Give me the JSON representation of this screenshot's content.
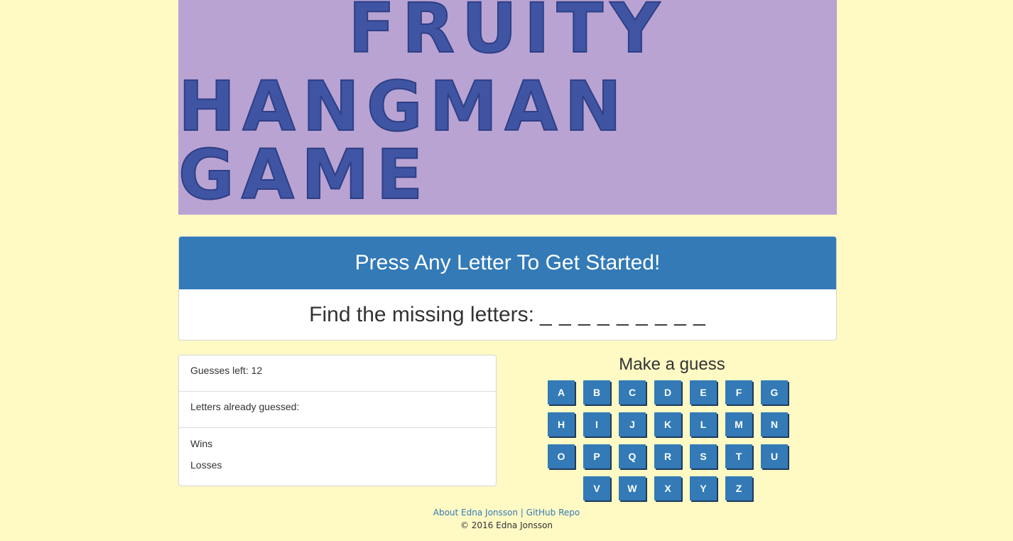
{
  "banner": {
    "line1": "FRUITY",
    "line2": "HANGMAN GAME"
  },
  "panel": {
    "heading": "Press Any Letter To Get Started!",
    "prompt": "Find the missing letters:",
    "blanks": "_ _ _ _ _ _ _ _ _"
  },
  "stats": {
    "guesses_left": "Guesses left: 12",
    "letters_guessed": "Letters already guessed:",
    "wins": "Wins",
    "losses": "Losses"
  },
  "guess": {
    "title": "Make a guess",
    "letters": [
      "A",
      "B",
      "C",
      "D",
      "E",
      "F",
      "G",
      "H",
      "I",
      "J",
      "K",
      "L",
      "M",
      "N",
      "O",
      "P",
      "Q",
      "R",
      "S",
      "T",
      "U",
      "V",
      "W",
      "X",
      "Y",
      "Z"
    ]
  },
  "footer": {
    "about_link": "About Edna Jonsson",
    "separator": "|",
    "repo_link": "GitHub Repo",
    "copyright": "© 2016 Edna Jonsson"
  },
  "colors": {
    "background": "#fff9c4",
    "banner": "#b9a3d3",
    "title_text": "#3f55a3",
    "primary": "#337ab7"
  }
}
